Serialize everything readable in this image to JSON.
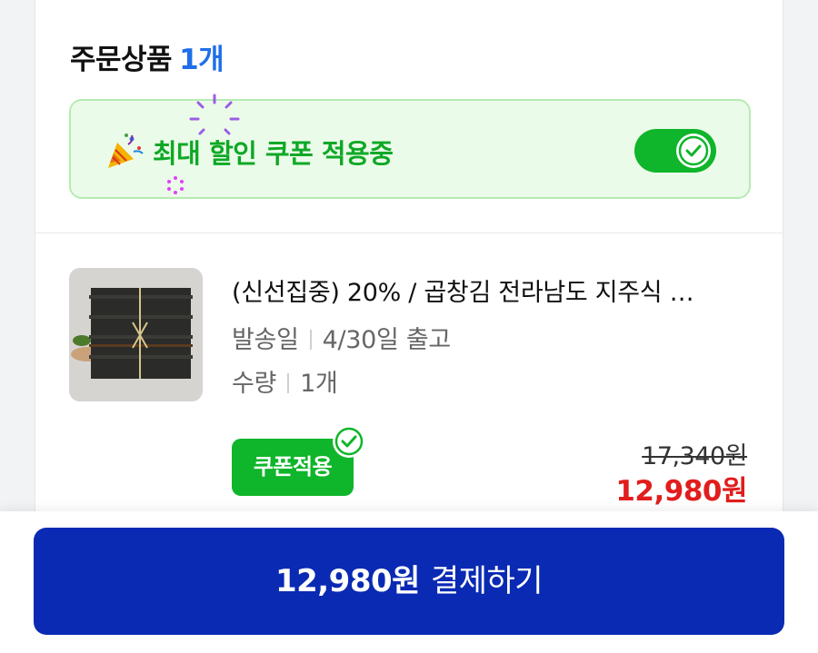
{
  "order": {
    "title": "주문상품",
    "count": "1개"
  },
  "coupon_banner": {
    "label": "최대 할인 쿠폰 적용중",
    "toggle_on": true,
    "accent_color": "#0fb52a"
  },
  "product": {
    "name": "(신선집중) 20% / 곱창김 전라남도 지주식 …",
    "ship_label": "발송일",
    "ship_value": "4/30일 출고",
    "qty_label": "수량",
    "qty_value": "1개",
    "coupon_badge": "쿠폰적용",
    "original_price": "17,340원",
    "sale_price": "12,980원"
  },
  "checkout": {
    "amount": "12,980원",
    "label": "결제하기",
    "button_color": "#0a2ab3"
  }
}
